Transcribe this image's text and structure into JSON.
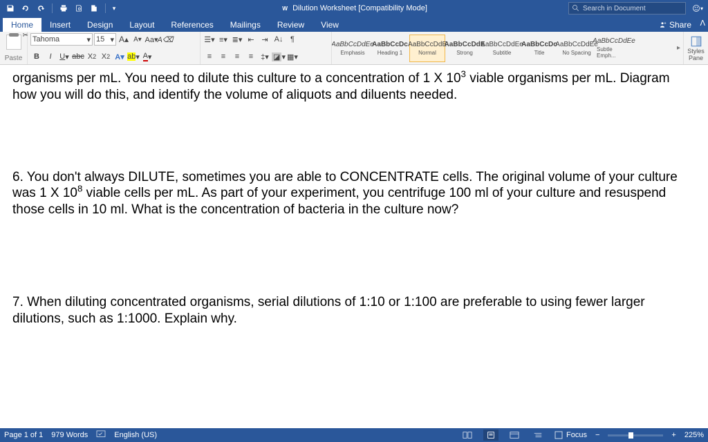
{
  "titlebar": {
    "title": "Dilution Worksheet [Compatibility Mode]",
    "search_placeholder": "Search in Document"
  },
  "tabs": {
    "items": [
      "Home",
      "Insert",
      "Design",
      "Layout",
      "References",
      "Mailings",
      "Review",
      "View"
    ],
    "active": 0,
    "share": "Share"
  },
  "ribbon": {
    "paste": "Paste",
    "font_name": "Tahoma",
    "font_size": "15",
    "styles": [
      {
        "sample": "AaBbCcDdEe",
        "name": "Emphasis",
        "italic": true
      },
      {
        "sample": "AaBbCcDc",
        "name": "Heading 1",
        "bold": true
      },
      {
        "sample": "AaBbCcDdE",
        "name": "Normal",
        "sel": true
      },
      {
        "sample": "AaBbCcDdE",
        "name": "Strong",
        "bold": true
      },
      {
        "sample": "AaBbCcDdEe",
        "name": "Subtitle"
      },
      {
        "sample": "AaBbCcDc",
        "name": "Title",
        "bold": true
      },
      {
        "sample": "AaBbCcDdEe",
        "name": "No Spacing"
      },
      {
        "sample": "AaBbCcDdEe",
        "name": "Subtle Emph...",
        "italic": true
      }
    ],
    "styles_pane": "Styles\nPane"
  },
  "document": {
    "p1_a": "organisms per mL.  You need to dilute this culture to a concentration of 1 X 10",
    "p1_sup": "3",
    "p1_b": " viable organisms per mL.  Diagram how you will do this, and identify the volume of aliquots and diluents needed.",
    "p2_a": "6.  You don't always DILUTE, sometimes you are able to CONCENTRATE cells.  The original volume of your culture was 1 X 10",
    "p2_sup": "8",
    "p2_b": " viable cells per mL.  As part of your experiment, you centrifuge 100 ml of your culture and resuspend those cells in 10 ml.  What is the concentration of bacteria in the culture now?",
    "p3": "7.  When diluting concentrated organisms, serial dilutions of 1:10 or 1:100 are preferable to using fewer larger dilutions, such as 1:1000.  Explain why."
  },
  "statusbar": {
    "page": "Page 1 of 1",
    "words": "979 Words",
    "language": "English (US)",
    "focus": "Focus",
    "zoom": "225%"
  }
}
